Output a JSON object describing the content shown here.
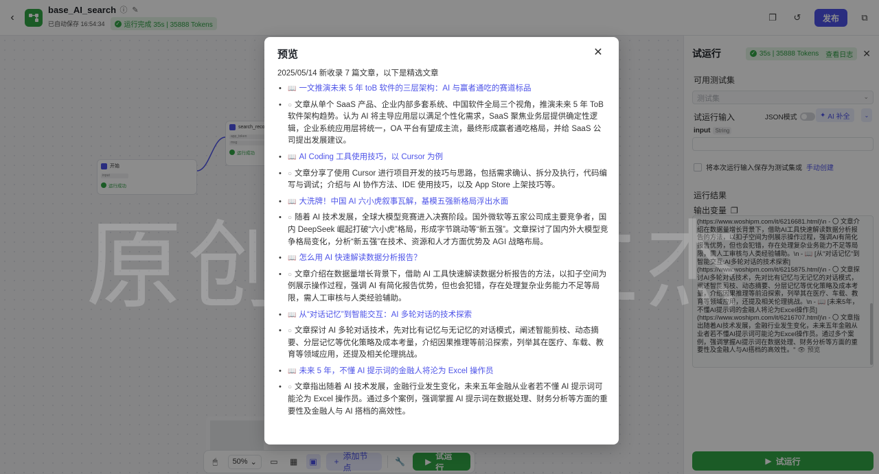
{
  "header": {
    "app_title": "base_AI_search",
    "autosave": "已自动保存 16:54:34",
    "run_status": "运行完成 35s | 35888 Tokens",
    "publish_label": "发布"
  },
  "canvas": {
    "node_start": {
      "title": "开始",
      "line": "input",
      "status": "运行成功",
      "time": "0.000s"
    },
    "node_search": {
      "title": "search_reco",
      "line1": "app_token",
      "line2": "msg",
      "status": "运行成功",
      "time": "0.000s"
    }
  },
  "toolbar": {
    "zoom": "50%",
    "add_node_label": "添加节点",
    "run_label": "试运行"
  },
  "panel": {
    "title": "试运行",
    "badge": "35s | 35888 Tokens",
    "badge_link": "查看日志",
    "testset_label": "可用测试集",
    "testset_placeholder": "测试集",
    "input_section_label": "试运行输入",
    "json_mode_label": "JSON模式",
    "ai_fill_label": "AI 补全",
    "input_name": "input",
    "input_type": "String",
    "save_text": "将本次运行输入保存为测试集或",
    "save_link": "手动创建",
    "result_label": "运行结果",
    "output_label": "输出变量",
    "output_text": "(https://www.woshipm.com/it/6216681.html)\\n - 〇 文章介绍在数据量增长背景下，借助AI工具快速解读数据分析报告的方法，以扣子空间为例展示操作过程，强调AI有简化报告优势，但也会犯错，存在处理复杂业务能力不足等局限，需人工审核与人类经验辅助。\\n - 📖 [从\"对话记忆\"到智能交互:AI多轮对话的技术探索](https://www.woshipm.com/it/6215875.html)\\n - 〇 文章探讨AI多轮对话技术，先对比有记忆与无记忆的对话模式，阐述智能剪枝、动态摘要、分层记忆等优化策略及成本考量，介绍因果推理等前沿探索，列举其在医疗、车载、教育等领域应用，还提及相关伦理挑战。\\n - 📖 [未来5年，不懂AI提示词的金融人将沦为Excel操作员](https://www.woshipm.com/it/6216707.html)\\n - 〇 文章指出随着AI技术发展，金融行业发生变化，未来五年金融从业者若不懂AI提示词可能沦为Excel操作员。通过多个案例，强调掌握AI提示词在数据处理、财务分析等方面的重要性及金融人与AI搭档的高效性。\"",
    "preview_link": "预览",
    "run_button": "试运行"
  },
  "watermark": "原创PM网仁杰",
  "modal": {
    "title": "预览",
    "intro": "2025/05/14 新收录 7 篇文章，以下是精选文章",
    "articles": [
      {
        "title": "一文推演未来 5 年 toB 软件的三层架构：AI 与赢者通吃的赛道标品",
        "desc": "文章从单个 SaaS 产品、企业内部多套系统、中国软件全局三个视角，推演未来 5 年 ToB 软件架构趋势。认为 AI 将主导应用层以满足个性化需求，SaaS 聚焦业务层提供确定性逻辑，企业系统应用层将统一，OA 平台有望成主流，最终形成赢者通吃格局，并给 SaaS 公司提出发展建议。"
      },
      {
        "title": "AI Coding 工具使用技巧，以 Cursor 为例",
        "desc": "文章分享了使用 Cursor 进行项目开发的技巧与思路，包括需求确认、拆分及执行，代码编写与调试；介绍与 AI 协作方法、IDE 使用技巧，以及 App Store 上架技巧等。"
      },
      {
        "title": "大洗牌！中国 AI 六小虎叙事瓦解，基模五强新格局浮出水面",
        "desc": "随着 AI 技术发展，全球大模型竞赛进入决赛阶段。国外微软等五家公司成主要竞争者，国内 DeepSeek 崛起打破“六小虎”格局，形成字节跳动等“新五强”。文章探讨了国内外大模型竞争格局变化，分析“新五强”在技术、资源和人才方面优势及 AGI 战略布局。"
      },
      {
        "title": "怎么用 AI 快速解读数据分析报告？",
        "desc": "文章介绍在数据量增长背景下，借助 AI 工具快速解读数据分析报告的方法，以扣子空间为例展示操作过程，强调 AI 有简化报告优势，但也会犯错，存在处理复杂业务能力不足等局限，需人工审核与人类经验辅助。"
      },
      {
        "title": "从“对话记忆”到智能交互：AI 多轮对话的技术探索",
        "desc": "文章探讨 AI 多轮对话技术，先对比有记忆与无记忆的对话模式，阐述智能剪枝、动态摘要、分层记忆等优化策略及成本考量，介绍因果推理等前沿探索，列举其在医疗、车载、教育等领域应用，还提及相关伦理挑战。"
      },
      {
        "title": "未来 5 年，不懂 AI 提示词的金融人将沦为 Excel 操作员",
        "desc": "文章指出随着 AI 技术发展，金融行业发生变化，未来五年金融从业者若不懂 AI 提示词可能沦为 Excel 操作员。通过多个案例，强调掌握 AI 提示词在数据处理、财务分析等方面的重要性及金融人与 AI 搭档的高效性。"
      }
    ]
  }
}
